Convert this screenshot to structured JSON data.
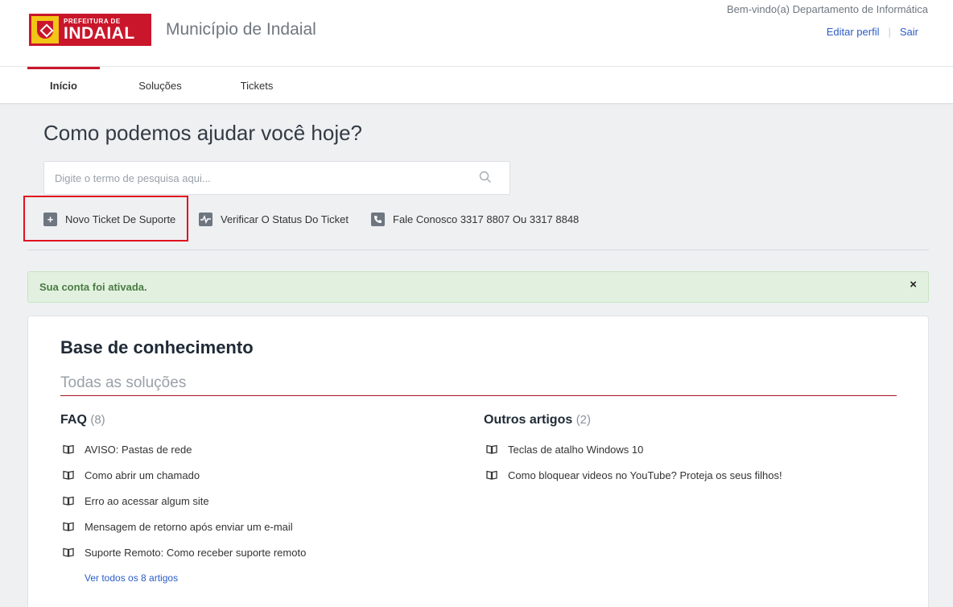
{
  "header": {
    "logo_small": "PREFEITURA DE",
    "logo_big": "INDAIAL",
    "site_title": "Município de Indaial",
    "welcome": "Bem-vindo(a) Departamento de Informática",
    "edit_profile": "Editar perfil",
    "logout": "Sair"
  },
  "nav": {
    "tabs": [
      {
        "label": "Início",
        "active": true
      },
      {
        "label": "Soluções",
        "active": false
      },
      {
        "label": "Tickets",
        "active": false
      }
    ]
  },
  "hero": {
    "title": "Como podemos ajudar você hoje?",
    "search_placeholder": "Digite o termo de pesquisa aqui..."
  },
  "actions": [
    {
      "label": "Novo Ticket De Suporte",
      "icon": "plus-icon"
    },
    {
      "label": "Verificar O Status Do Ticket",
      "icon": "pulse-icon"
    },
    {
      "label": "Fale Conosco 3317 8807 Ou 3317 8848",
      "icon": "phone-icon"
    }
  ],
  "alert": {
    "text": "Sua conta foi ativada.",
    "close": "×",
    "color": "#e2f1df"
  },
  "knowledge_base": {
    "title": "Base de conhecimento",
    "subtitle": "Todas as soluções",
    "faq": {
      "title": "FAQ",
      "count": "(8)",
      "articles": [
        "AVISO: Pastas de rede",
        "Como abrir um chamado",
        "Erro ao acessar algum site",
        "Mensagem de retorno após enviar um e-mail",
        "Suporte Remoto: Como receber suporte remoto"
      ],
      "view_all": "Ver todos os 8 artigos"
    },
    "other": {
      "title": "Outros artigos",
      "count": "(2)",
      "articles": [
        "Teclas de atalho Windows 10",
        "Como bloquear videos no YouTube? Proteja os seus filhos!"
      ]
    }
  },
  "colors": {
    "brand": "#c9162b",
    "link": "#2c5cc5",
    "highlight_box": "#e0121d"
  }
}
